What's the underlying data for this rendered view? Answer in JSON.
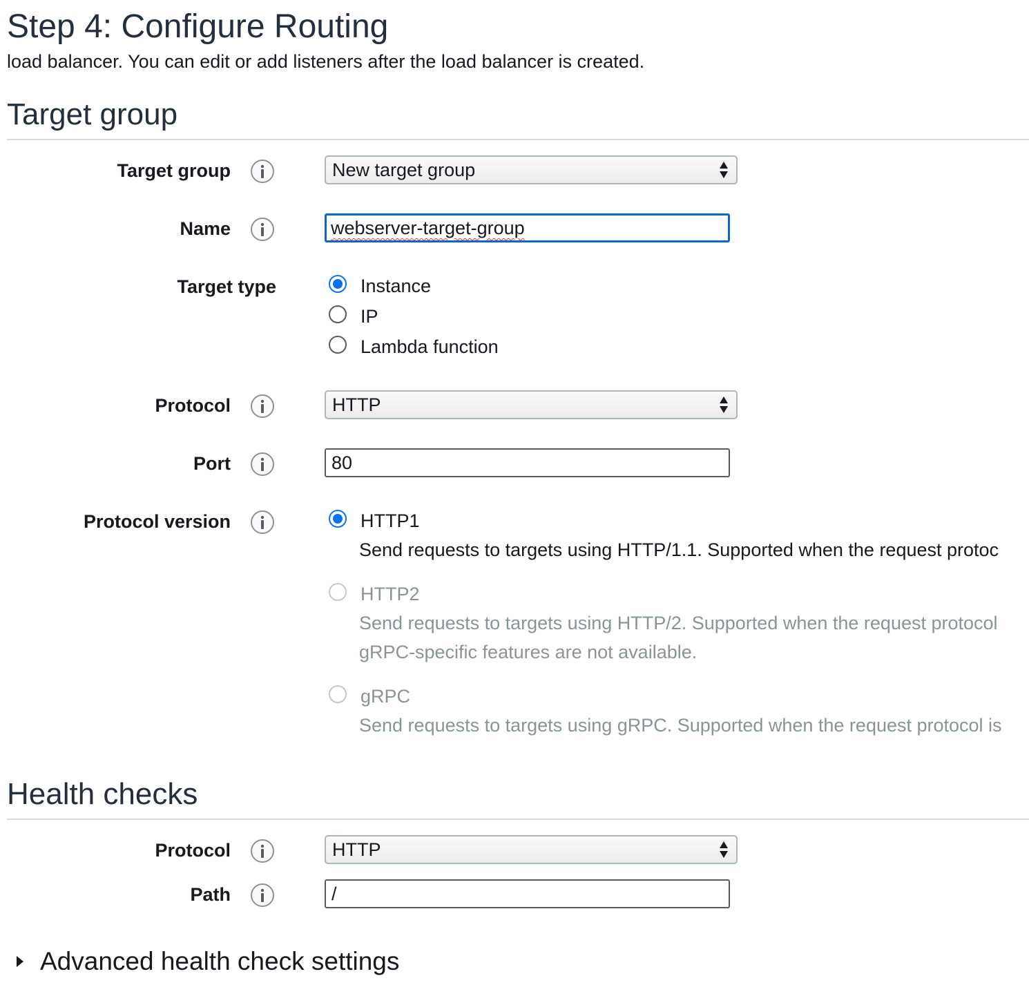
{
  "header": {
    "title": "Step 4: Configure Routing",
    "description": "load balancer. You can edit or add listeners after the load balancer is created."
  },
  "target_group_section": {
    "title": "Target group",
    "target_group": {
      "label": "Target group",
      "value": "New target group"
    },
    "name": {
      "label": "Name",
      "value": "webserver-target-group"
    },
    "target_type": {
      "label": "Target type",
      "options": [
        {
          "label": "Instance",
          "checked": true
        },
        {
          "label": "IP",
          "checked": false
        },
        {
          "label": "Lambda function",
          "checked": false
        }
      ]
    },
    "protocol": {
      "label": "Protocol",
      "value": "HTTP"
    },
    "port": {
      "label": "Port",
      "value": "80"
    },
    "protocol_version": {
      "label": "Protocol version",
      "options": [
        {
          "label": "HTTP1",
          "description": "Send requests to targets using HTTP/1.1. Supported when the request protoc",
          "checked": true,
          "disabled": false
        },
        {
          "label": "HTTP2",
          "description_line1": "Send requests to targets using HTTP/2. Supported when the request protocol",
          "description_line2": "gRPC-specific features are not available.",
          "checked": false,
          "disabled": true
        },
        {
          "label": "gRPC",
          "description": "Send requests to targets using gRPC. Supported when the request protocol is",
          "checked": false,
          "disabled": true
        }
      ]
    }
  },
  "health_checks_section": {
    "title": "Health checks",
    "protocol": {
      "label": "Protocol",
      "value": "HTTP"
    },
    "path": {
      "label": "Path",
      "value": "/"
    },
    "advanced_label": "Advanced health check settings"
  },
  "colors": {
    "accent": "#0a73eb",
    "focus_border": "#0a66c9",
    "disabled_text": "#879596",
    "rule": "#d5dbdb"
  },
  "icons": {
    "info": "info-icon",
    "select_caret": "up-down-caret-icon",
    "expander": "caret-right-icon"
  }
}
